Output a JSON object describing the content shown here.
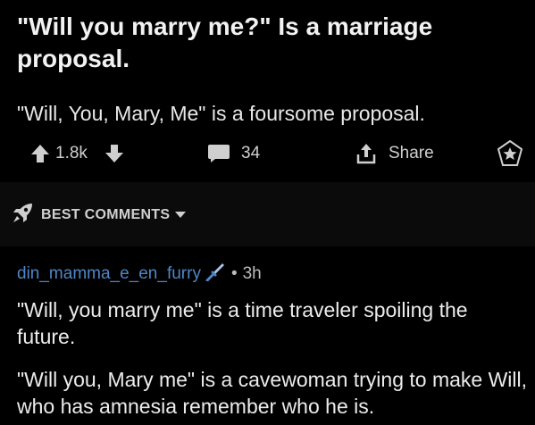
{
  "post": {
    "title": "\"Will you marry me?\" Is a marriage proposal.",
    "body": "\"Will, You, Mary, Me\" is a foursome proposal.",
    "score": "1.8k",
    "comment_count": "34",
    "share_label": "Share",
    "icons": {
      "upvote": "arrow-up-icon",
      "downvote": "arrow-down-icon",
      "comments": "comment-bubble-icon",
      "share": "share-icon",
      "award": "award-icon"
    }
  },
  "sort": {
    "label": "BEST COMMENTS",
    "icon": "rocket-icon"
  },
  "comment": {
    "username": "din_mamma_e_en_furry",
    "flair_icon": "sword-icon",
    "separator": "•",
    "age": "3h",
    "paragraphs": [
      "\"Will, you marry me\" is a time traveler spoiling the future.",
      "\"Will you, Mary me\" is a cavewoman trying to make Will, who has amnesia remember who he is."
    ]
  },
  "colors": {
    "background": "#000000",
    "band": "#0b0b0b",
    "username": "#4f86c6",
    "text": "#e6e6e6"
  }
}
